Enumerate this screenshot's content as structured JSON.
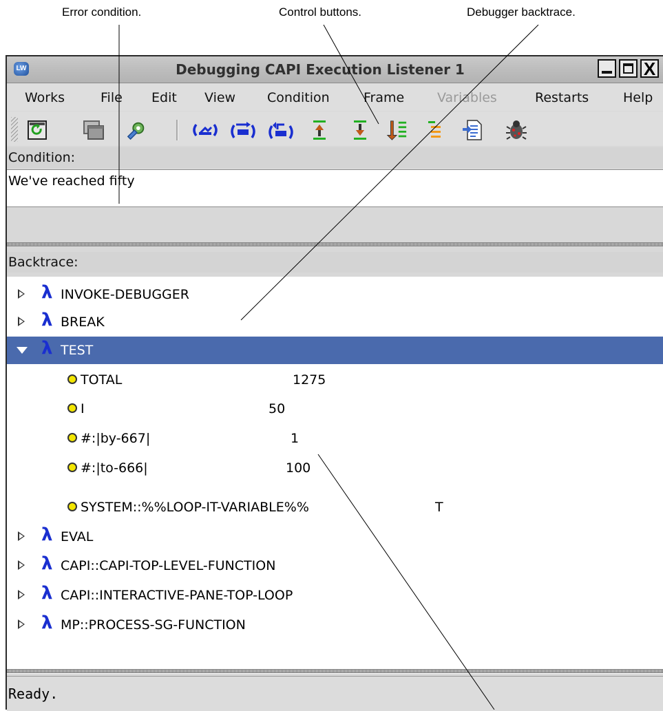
{
  "annotations": {
    "error_condition": "Error condition.",
    "control_buttons": "Control buttons.",
    "debugger_backtrace": "Debugger backtrace."
  },
  "window": {
    "title": "Debugging CAPI Execution Listener 1",
    "app_icon": "LW",
    "close_glyph": "X"
  },
  "menubar": [
    "Works",
    "File",
    "Edit",
    "View",
    "Condition",
    "Frame",
    "Variables",
    "Restarts",
    "Help"
  ],
  "menubar_disabled": [
    "Variables"
  ],
  "toolbar": {
    "icons": [
      "refresh-icon",
      "windows-icon",
      "gear-tools-icon",
      "abort-icon",
      "continue-icon",
      "return-icon",
      "frame-up-icon",
      "frame-down-icon",
      "frame-bottom-icon",
      "frame-top-icon",
      "edit-source-icon",
      "bug-icon"
    ]
  },
  "condition": {
    "label": "Condition:",
    "text": "We've reached fifty"
  },
  "backtrace": {
    "label": "Backtrace:",
    "lambda_glyph": "λ",
    "frames": [
      {
        "name": "INVOKE-DEBUGGER",
        "expanded": false
      },
      {
        "name": "BREAK",
        "expanded": false
      },
      {
        "name": "TEST",
        "expanded": true,
        "selected": true,
        "variables": [
          {
            "name": "TOTAL",
            "value": "1275"
          },
          {
            "name": "I",
            "value": "50"
          },
          {
            "name": "#:|by-667|",
            "value": "1"
          },
          {
            "name": "#:|to-666|",
            "value": "100"
          },
          {
            "name": "SYSTEM::%%LOOP-IT-VARIABLE%%",
            "value": "T"
          }
        ]
      },
      {
        "name": "EVAL",
        "expanded": false
      },
      {
        "name": "CAPI::CAPI-TOP-LEVEL-FUNCTION",
        "expanded": false
      },
      {
        "name": "CAPI::INTERACTIVE-PANE-TOP-LOOP",
        "expanded": false
      },
      {
        "name": "MP::PROCESS-SG-FUNCTION",
        "expanded": false
      }
    ]
  },
  "status": "Ready.",
  "colors": {
    "selection": "#4a6aad",
    "lambda": "#1a2fd0",
    "variable_dot": "#f3e600"
  }
}
